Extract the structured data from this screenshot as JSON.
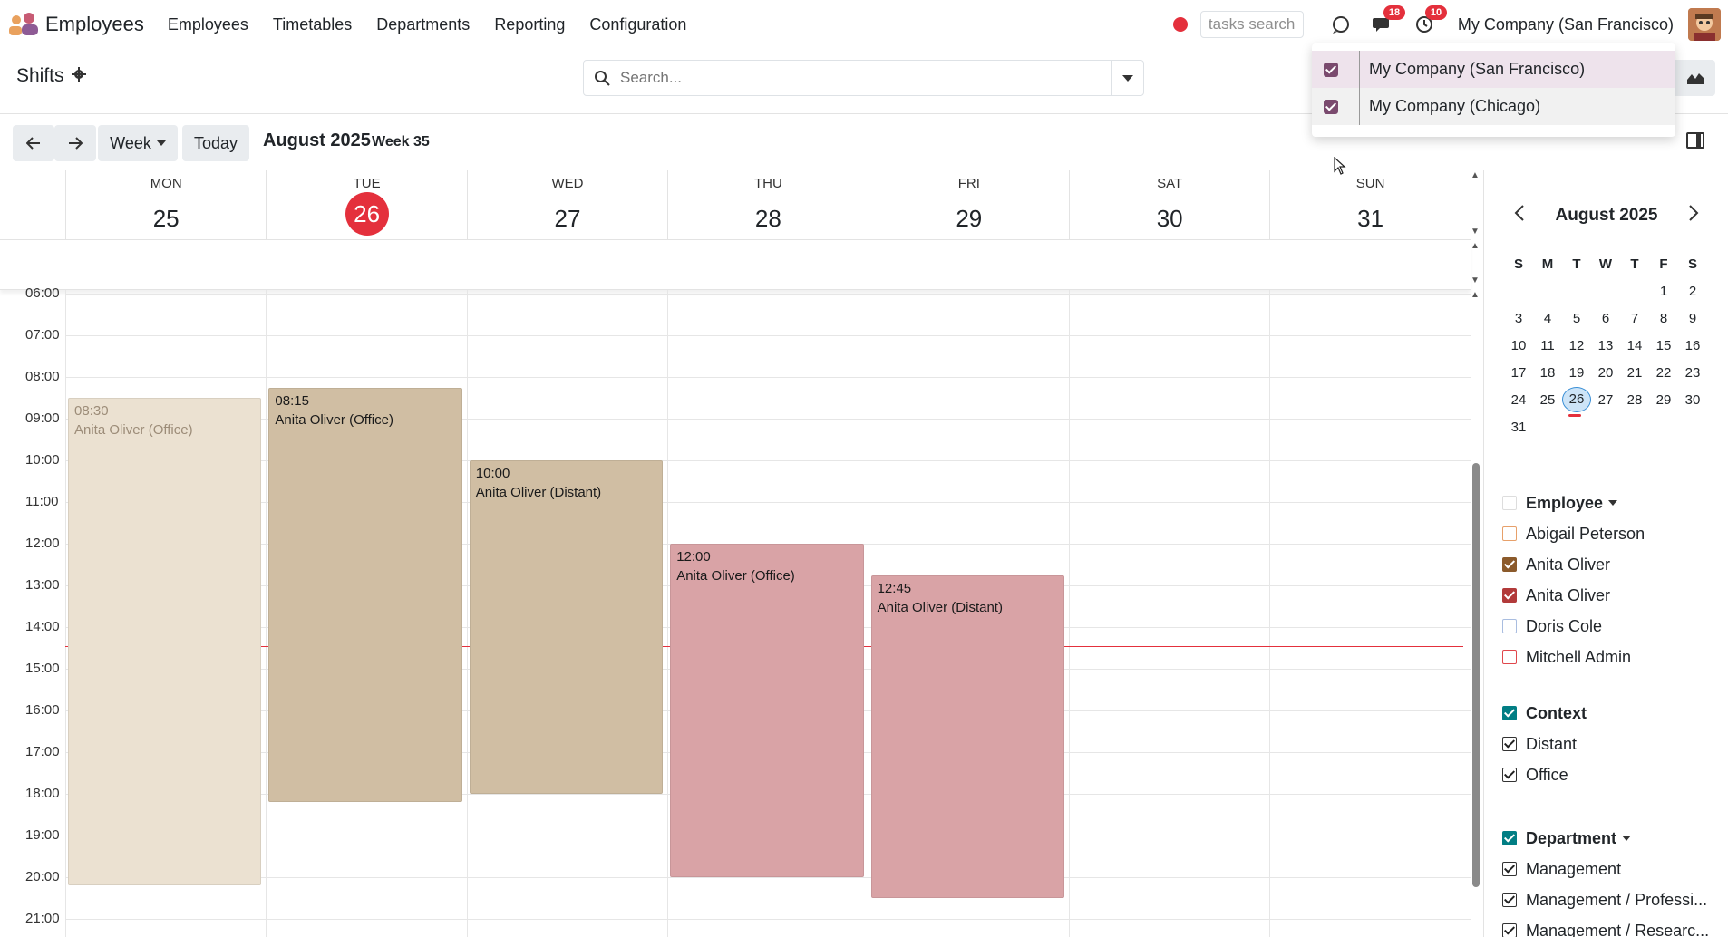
{
  "navbar": {
    "app_name": "Employees",
    "menu": [
      "Employees",
      "Timetables",
      "Departments",
      "Reporting",
      "Configuration"
    ],
    "tasks_search_placeholder": "tasks search",
    "chat_badge": "18",
    "activity_badge": "10",
    "company": "My Company (San Francisco)"
  },
  "control_panel": {
    "title": "Shifts",
    "search_placeholder": "Search..."
  },
  "company_dropdown": {
    "items": [
      "My Company (San Francisco)",
      "My Company (Chicago)"
    ]
  },
  "toolbar": {
    "scale_label": "Week",
    "today_label": "Today",
    "period_title": "August 2025",
    "week_label": "Week 35"
  },
  "days": [
    {
      "name": "MON",
      "num": "25"
    },
    {
      "name": "TUE",
      "num": "26"
    },
    {
      "name": "WED",
      "num": "27"
    },
    {
      "name": "THU",
      "num": "28"
    },
    {
      "name": "FRI",
      "num": "29"
    },
    {
      "name": "SAT",
      "num": "30"
    },
    {
      "name": "SUN",
      "num": "31"
    }
  ],
  "hours": [
    "06:00",
    "07:00",
    "08:00",
    "09:00",
    "10:00",
    "11:00",
    "12:00",
    "13:00",
    "14:00",
    "15:00",
    "16:00",
    "17:00",
    "18:00",
    "19:00",
    "20:00",
    "21:00"
  ],
  "events": [
    {
      "day": 0,
      "time": "08:30",
      "title": "Anita Oliver (Office)",
      "start": 8.5,
      "end": 20.2,
      "style": "faded"
    },
    {
      "day": 1,
      "time": "08:15",
      "title": "Anita Oliver (Office)",
      "start": 8.25,
      "end": 18.2,
      "style": "tan"
    },
    {
      "day": 2,
      "time": "10:00",
      "title": "Anita Oliver (Distant)",
      "start": 10.0,
      "end": 18.0,
      "style": "tan"
    },
    {
      "day": 3,
      "time": "12:00",
      "title": "Anita Oliver (Office)",
      "start": 12.0,
      "end": 20.0,
      "style": "pink"
    },
    {
      "day": 4,
      "time": "12:45",
      "title": "Anita Oliver (Distant)",
      "start": 12.75,
      "end": 20.5,
      "style": "pink"
    }
  ],
  "now_hour": 14.45,
  "mini_calendar": {
    "title": "August 2025",
    "weekdays": [
      "S",
      "M",
      "T",
      "W",
      "T",
      "F",
      "S"
    ],
    "weeks": [
      [
        "",
        "",
        "",
        "",
        "",
        "1",
        "2"
      ],
      [
        "3",
        "4",
        "5",
        "6",
        "7",
        "8",
        "9"
      ],
      [
        "10",
        "11",
        "12",
        "13",
        "14",
        "15",
        "16"
      ],
      [
        "17",
        "18",
        "19",
        "20",
        "21",
        "22",
        "23"
      ],
      [
        "24",
        "25",
        "26",
        "27",
        "28",
        "29",
        "30"
      ],
      [
        "31",
        "",
        "",
        "",
        "",
        "",
        ""
      ]
    ],
    "today": "26"
  },
  "filters": {
    "employee": {
      "title": "Employee",
      "items": [
        {
          "label": "Abigail Peterson",
          "checked": false,
          "color": "#e7a06a"
        },
        {
          "label": "Anita Oliver",
          "checked": true,
          "color": "#8b5a2b"
        },
        {
          "label": "Anita Oliver",
          "checked": true,
          "color": "#b23a3a"
        },
        {
          "label": "Doris Cole",
          "checked": false,
          "color": "#a9bde0"
        },
        {
          "label": "Mitchell Admin",
          "checked": false,
          "color": "#e0474c"
        }
      ]
    },
    "context": {
      "title": "Context",
      "items": [
        {
          "label": "Distant",
          "checked": true
        },
        {
          "label": "Office",
          "checked": true
        }
      ]
    },
    "department": {
      "title": "Department",
      "items": [
        {
          "label": "Management",
          "checked": true
        },
        {
          "label": "Management / Professi...",
          "checked": true
        },
        {
          "label": "Management / Researc...",
          "checked": true
        }
      ]
    }
  },
  "colors": {
    "accent": "#017e84",
    "today_red": "#e4303c",
    "brand": "#714b67"
  }
}
